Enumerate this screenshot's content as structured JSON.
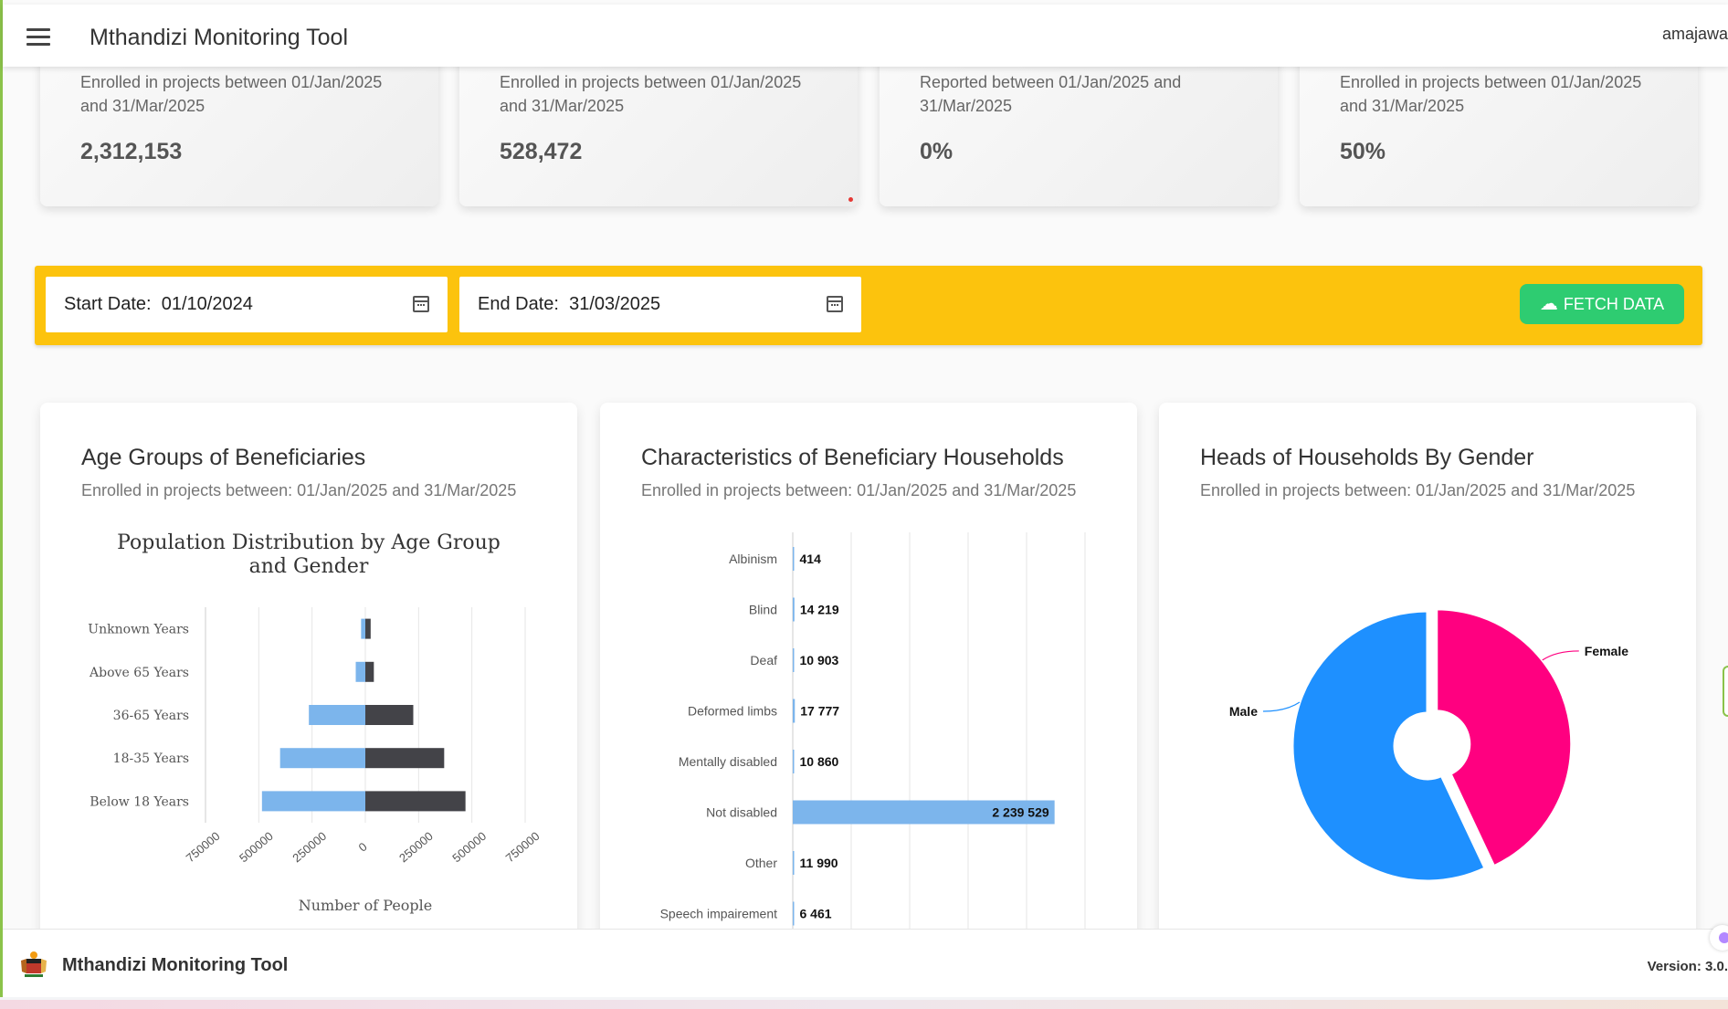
{
  "header": {
    "title": "Mthandizi Monitoring Tool",
    "username": "amajawa"
  },
  "stat_cards": [
    {
      "subtitle": "Enrolled in projects between 01/Jan/2025 and 31/Mar/2025",
      "value": "2,312,153"
    },
    {
      "subtitle": "Enrolled in projects between 01/Jan/2025 and 31/Mar/2025",
      "value": "528,472"
    },
    {
      "subtitle": "Reported between 01/Jan/2025 and 31/Mar/2025",
      "value": "0%"
    },
    {
      "subtitle": "Enrolled in projects between 01/Jan/2025 and 31/Mar/2025",
      "value": "50%"
    }
  ],
  "filters": {
    "start_date_label": "Start Date:",
    "start_date_value": "01/10/2024",
    "end_date_label": "End Date:",
    "end_date_value": "31/03/2025",
    "fetch_label": "FETCH DATA"
  },
  "cards": {
    "age": {
      "title": "Age Groups of Beneficiaries",
      "subtitle": "Enrolled in projects between: 01/Jan/2025 and 31/Mar/2025"
    },
    "households": {
      "title": "Characteristics of Beneficiary Households",
      "subtitle": "Enrolled in projects between: 01/Jan/2025 and 31/Mar/2025"
    },
    "gender": {
      "title": "Heads of Households By Gender",
      "subtitle": "Enrolled in projects between: 01/Jan/2025 and 31/Mar/2025"
    }
  },
  "footer": {
    "title": "Mthandizi Monitoring Tool",
    "version": "Version: 3.0."
  },
  "colors": {
    "accent_yellow": "#fcc30d",
    "fetch_green": "#2ecc71",
    "bar_light_blue": "#7cb5ec",
    "bar_dark": "#434348",
    "male_blue": "#1e90ff",
    "female_pink": "#ff0080"
  },
  "chart_data": [
    {
      "type": "bar",
      "orientation": "horizontal",
      "title": "Population Distribution by Age Group and Gender",
      "xlabel": "Number of People",
      "categories": [
        "Unknown Years",
        "Above 65 Years",
        "36-65 Years",
        "18-35 Years",
        "Below 18 Years"
      ],
      "xlim": [
        -750000,
        750000
      ],
      "xticks": [
        "750000",
        "500000",
        "250000",
        "0",
        "250000",
        "500000",
        "750000"
      ],
      "series": [
        {
          "values": [
            -20000,
            -45000,
            -265000,
            -400000,
            -485000
          ]
        },
        {
          "values": [
            25000,
            40000,
            225000,
            370000,
            470000
          ]
        }
      ],
      "grid": true
    },
    {
      "type": "bar",
      "orientation": "horizontal",
      "categories": [
        "Albinism",
        "Blind",
        "Deaf",
        "Deformed limbs",
        "Mentally disabled",
        "Not disabled",
        "Other",
        "Speech impairement"
      ],
      "values": [
        414,
        14219,
        10903,
        17777,
        10860,
        2239529,
        11990,
        6461
      ],
      "data_labels": [
        "414",
        "14 219",
        "10 903",
        "17 777",
        "10 860",
        "2 239 529",
        "11 990",
        "6 461"
      ],
      "xlim": [
        0,
        2500000
      ],
      "grid": true
    },
    {
      "type": "pie",
      "style": "donut",
      "slices": [
        {
          "label": "Female",
          "value": 43
        },
        {
          "label": "Male",
          "value": 57
        }
      ]
    }
  ]
}
